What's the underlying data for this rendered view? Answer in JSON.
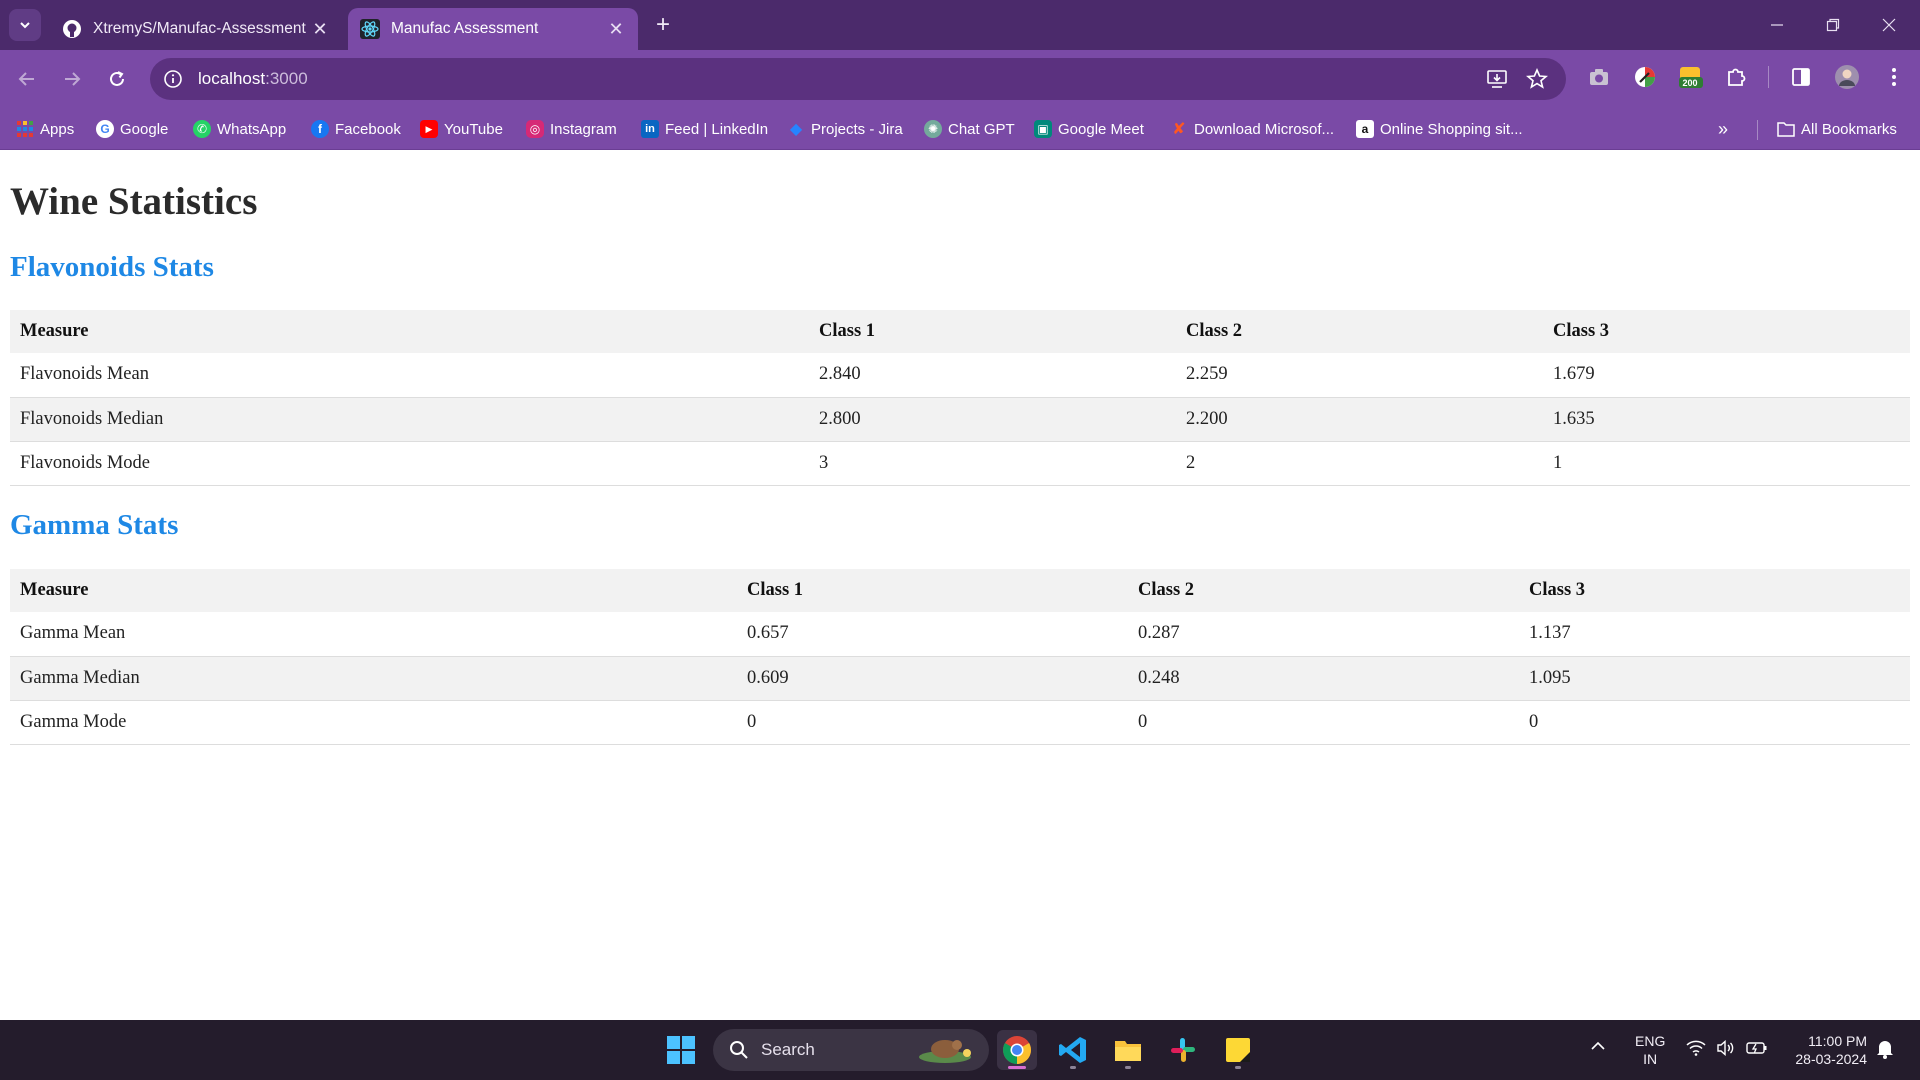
{
  "browser": {
    "tabs": [
      {
        "title": "XtremyS/Manufac-Assessment",
        "favicon": "github-icon",
        "active": false
      },
      {
        "title": "Manufac Assessment",
        "favicon": "react-icon",
        "active": true
      }
    ],
    "address": {
      "host": "localhost",
      "port": ":3000"
    },
    "extension_badge": "200",
    "bookmarks": [
      {
        "label": "Apps",
        "icon": "apps-grid-icon"
      },
      {
        "label": "Google",
        "icon": "google-icon"
      },
      {
        "label": "WhatsApp",
        "icon": "whatsapp-icon"
      },
      {
        "label": "Facebook",
        "icon": "facebook-icon"
      },
      {
        "label": "YouTube",
        "icon": "youtube-icon"
      },
      {
        "label": "Instagram",
        "icon": "instagram-icon"
      },
      {
        "label": "Feed | LinkedIn",
        "icon": "linkedin-icon"
      },
      {
        "label": "Projects - Jira",
        "icon": "jira-icon"
      },
      {
        "label": "Chat GPT",
        "icon": "chatgpt-icon"
      },
      {
        "label": "Google Meet",
        "icon": "google-meet-icon"
      },
      {
        "label": "Download Microsof...",
        "icon": "microsoft-icon"
      },
      {
        "label": "Online Shopping sit...",
        "icon": "amazon-icon"
      }
    ],
    "all_bookmarks": "All Bookmarks"
  },
  "page": {
    "title": "Wine Statistics",
    "flavonoids": {
      "heading": "Flavonoids Stats",
      "headers": [
        "Measure",
        "Class 1",
        "Class 2",
        "Class 3"
      ],
      "rows": [
        [
          "Flavonoids Mean",
          "2.840",
          "2.259",
          "1.679"
        ],
        [
          "Flavonoids Median",
          "2.800",
          "2.200",
          "1.635"
        ],
        [
          "Flavonoids Mode",
          "3",
          "2",
          "1"
        ]
      ]
    },
    "gamma": {
      "heading": "Gamma Stats",
      "headers": [
        "Measure",
        "Class 1",
        "Class 2",
        "Class 3"
      ],
      "rows": [
        [
          "Gamma Mean",
          "0.657",
          "0.287",
          "1.137"
        ],
        [
          "Gamma Median",
          "0.609",
          "0.248",
          "1.095"
        ],
        [
          "Gamma Mode",
          "0",
          "0",
          "0"
        ]
      ]
    }
  },
  "taskbar": {
    "search_label": "Search",
    "lang": "ENG",
    "region": "IN",
    "time": "11:00 PM",
    "date": "28-03-2024"
  },
  "colors": {
    "tab_strip": "#4b2a6b",
    "toolbar": "#7a4aa6",
    "heading_blue": "#1e88e5",
    "taskbar": "#241c2c"
  }
}
